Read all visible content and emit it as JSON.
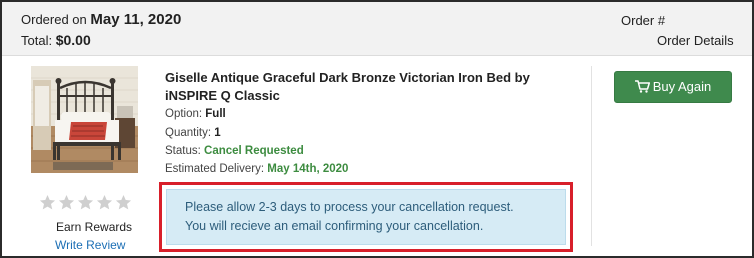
{
  "order": {
    "ordered_label": "Ordered on",
    "ordered_date": "May 11, 2020",
    "total_label": "Total:",
    "total_value": "$0.00",
    "order_number_label": "Order #",
    "order_details_label": "Order Details"
  },
  "product": {
    "title": "Giselle Antique Graceful Dark Bronze Victorian Iron Bed by iNSPIRE Q Classic",
    "image_icon": "iron-bed-photo",
    "option_label": "Option:",
    "option_value": "Full",
    "quantity_label": "Quantity:",
    "quantity_value": "1",
    "status_label": "Status:",
    "status_value": "Cancel Requested",
    "delivery_label": "Estimated Delivery:",
    "delivery_value": "May 14th, 2020"
  },
  "rating": {
    "stars_total": 5,
    "stars_filled": 0,
    "star_icon": "star-icon",
    "earn_rewards": "Earn Rewards",
    "write_review": "Write Review"
  },
  "actions": {
    "buy_again_label": "Buy Again",
    "buy_again_icon": "cart-icon"
  },
  "notice": {
    "line1": "Please allow 2-3 days to process your cancellation request.",
    "line2": "You will recieve an email confirming your cancellation."
  },
  "colors": {
    "header_bg": "#f2f2f2",
    "buy_again_bg": "#3f8a4d",
    "status_green": "#3d8c40",
    "link_blue": "#1c6fb5",
    "notice_bg": "#d6ebf5",
    "notice_text": "#2d5d7b",
    "highlight_red": "#d81f2a",
    "star_gray": "#cfcfcf"
  }
}
